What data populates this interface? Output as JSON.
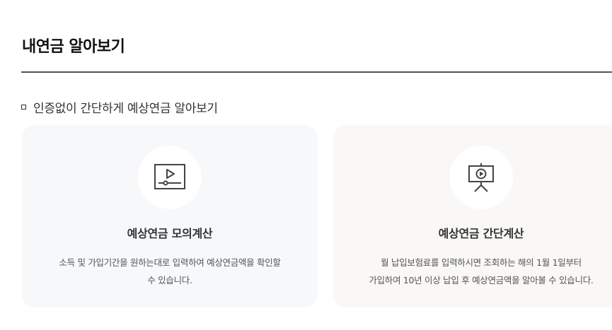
{
  "header": {
    "title": "내연금 알아보기"
  },
  "section": {
    "heading": "인증없이 간단하게 예상연금 알아보기"
  },
  "cards": [
    {
      "icon": "video-play-icon",
      "title": "예상연금 모의계산",
      "desc_line1": "소득 및 가입기간을 원하는대로 입력하여 예상연금액을 확인할",
      "desc_line2": "수 있습니다."
    },
    {
      "icon": "presentation-play-icon",
      "title": "예상연금 간단계산",
      "desc_line1": "월 납입보험료를 입력하시면 조회하는 해의 1월 1일부터",
      "desc_line2": "가입하여 10년 이상 납입 후 예상연금액을 알아볼 수 있습니다."
    }
  ]
}
